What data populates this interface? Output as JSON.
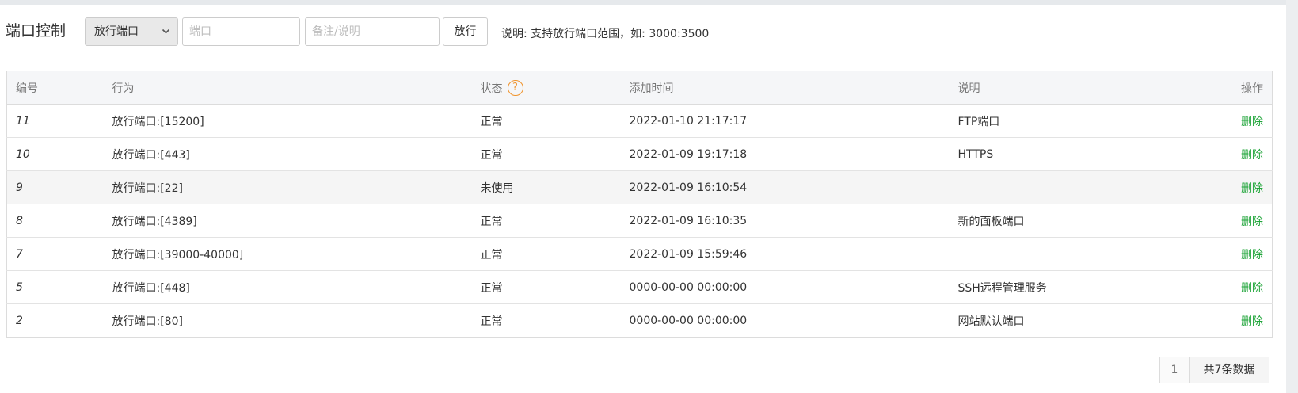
{
  "header": {
    "title": "端口控制",
    "action_select": "放行端口",
    "port_placeholder": "端口",
    "note_placeholder": "备注/说明",
    "allow_button": "放行",
    "hint": "说明: 支持放行端口范围，如: 3000:3500"
  },
  "table": {
    "columns": {
      "id": "编号",
      "action": "行为",
      "status": "状态",
      "time": "添加时间",
      "note": "说明",
      "op": "操作"
    },
    "help_symbol": "?",
    "rows": [
      {
        "id": "11",
        "action": "放行端口:[15200]",
        "status": "正常",
        "time": "2022-01-10 21:17:17",
        "note": "FTP端口",
        "op": "删除"
      },
      {
        "id": "10",
        "action": "放行端口:[443]",
        "status": "正常",
        "time": "2022-01-09 19:17:18",
        "note": "HTTPS",
        "op": "删除"
      },
      {
        "id": "9",
        "action": "放行端口:[22]",
        "status": "未使用",
        "time": "2022-01-09 16:10:54",
        "note": "",
        "op": "删除"
      },
      {
        "id": "8",
        "action": "放行端口:[4389]",
        "status": "正常",
        "time": "2022-01-09 16:10:35",
        "note": "新的面板端口",
        "op": "删除"
      },
      {
        "id": "7",
        "action": "放行端口:[39000-40000]",
        "status": "正常",
        "time": "2022-01-09 15:59:46",
        "note": "",
        "op": "删除"
      },
      {
        "id": "5",
        "action": "放行端口:[448]",
        "status": "正常",
        "time": "0000-00-00 00:00:00",
        "note": "SSH远程管理服务",
        "op": "删除"
      },
      {
        "id": "2",
        "action": "放行端口:[80]",
        "status": "正常",
        "time": "0000-00-00 00:00:00",
        "note": "网站默认端口",
        "op": "删除"
      }
    ]
  },
  "pager": {
    "page": "1",
    "total": "共7条数据"
  },
  "colors": {
    "accent_green": "#20a53a",
    "help_orange": "#f0932b"
  }
}
